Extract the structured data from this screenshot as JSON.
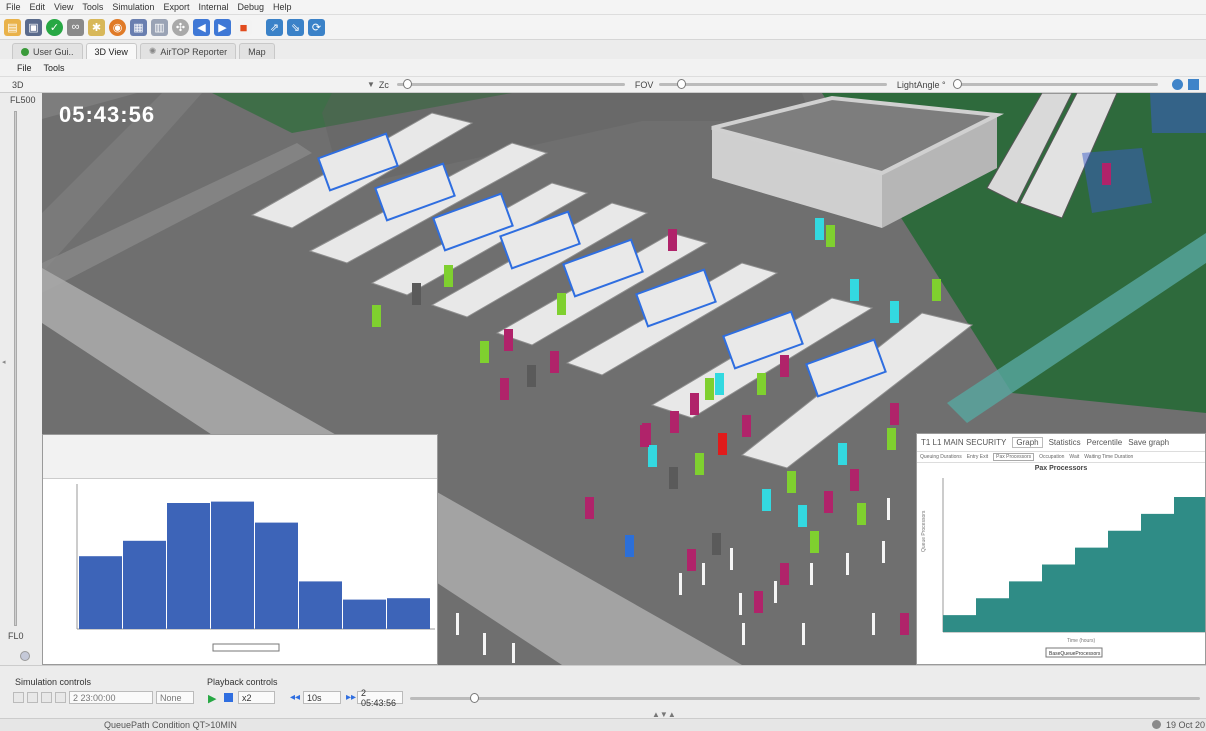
{
  "menu": [
    "File",
    "Edit",
    "View",
    "Tools",
    "Simulation",
    "Export",
    "Internal",
    "Debug",
    "Help"
  ],
  "tabs": [
    {
      "label": "User Gui..",
      "active": false
    },
    {
      "label": "3D View",
      "active": true
    },
    {
      "label": "AirTOP Reporter",
      "active": false
    },
    {
      "label": "Map",
      "active": false
    }
  ],
  "submenu": [
    "File",
    "Tools"
  ],
  "viewbar": {
    "mode": "3D",
    "zoom_label": "Zc",
    "fov_label": "FOV",
    "light_label": "LightAngle °"
  },
  "level": {
    "top": "FL500",
    "bottom": "FL0"
  },
  "clock": "05:43:56",
  "histogram_panel": {
    "values": [
      52,
      63,
      90,
      91,
      76,
      34,
      21,
      22
    ]
  },
  "step_panel": {
    "title": "T1 L1 MAIN SECURITY",
    "buttons": [
      "Graph",
      "Statistics",
      "Percentile",
      "Save graph"
    ],
    "subtabs": [
      "Queuing Durations",
      "Entry Exit",
      "Pax Processors",
      "Occupation",
      "Wait",
      "Waiting Time Duration"
    ],
    "chart_title": "Pax Processors",
    "ylabel": "Queue Processors",
    "xlabel": "Time (hours)",
    "legend": "BaseQueueProcessors",
    "values": [
      0,
      1,
      2,
      3,
      4,
      5,
      6,
      7
    ]
  },
  "simulation_controls": {
    "label": "Simulation controls",
    "time": "2 23:00:00",
    "unit": "None"
  },
  "playback_controls": {
    "label": "Playback controls",
    "speed": "x2",
    "step": "10s",
    "time": "2 05:43:56"
  },
  "status": {
    "left": "QueuePath Condition QT>10MIN",
    "right": "19 Oct 20"
  }
}
